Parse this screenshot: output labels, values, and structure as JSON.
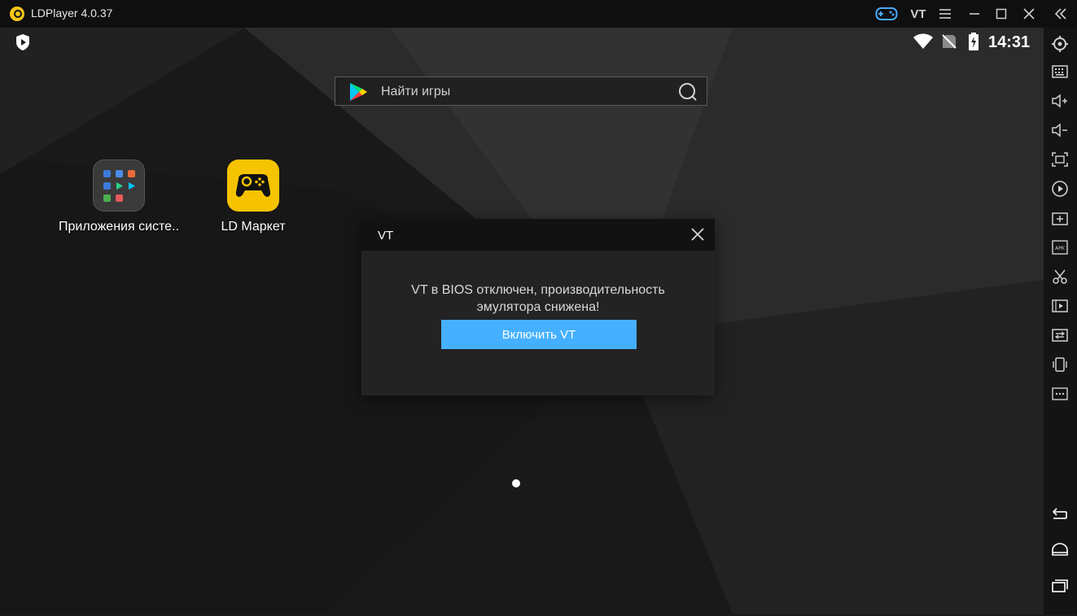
{
  "window": {
    "title": "LDPlayer 4.0.37",
    "vt_label": "VT"
  },
  "statusbar": {
    "time": "14:31"
  },
  "search": {
    "placeholder": "Найти игры"
  },
  "apps": [
    {
      "label": "Приложения систе.."
    },
    {
      "label": "LD Маркет"
    }
  ],
  "dialog": {
    "title": "VT",
    "message_line1": "VT в BIOS отключен, производительность",
    "message_line2": "эмулятора снижена!",
    "button_label": "Включить VT"
  },
  "colors": {
    "accent": "#45b0ff",
    "ld_market": "#f6c300"
  },
  "sidebar_icons": [
    "settings-icon",
    "keyboard-icon",
    "volume-up-icon",
    "volume-down-icon",
    "fullscreen-icon",
    "record-icon",
    "add-window-icon",
    "apk-icon",
    "scissors-icon",
    "video-icon",
    "sync-icon",
    "shake-icon",
    "more-icon",
    "back-icon",
    "home-icon",
    "recents-icon"
  ]
}
